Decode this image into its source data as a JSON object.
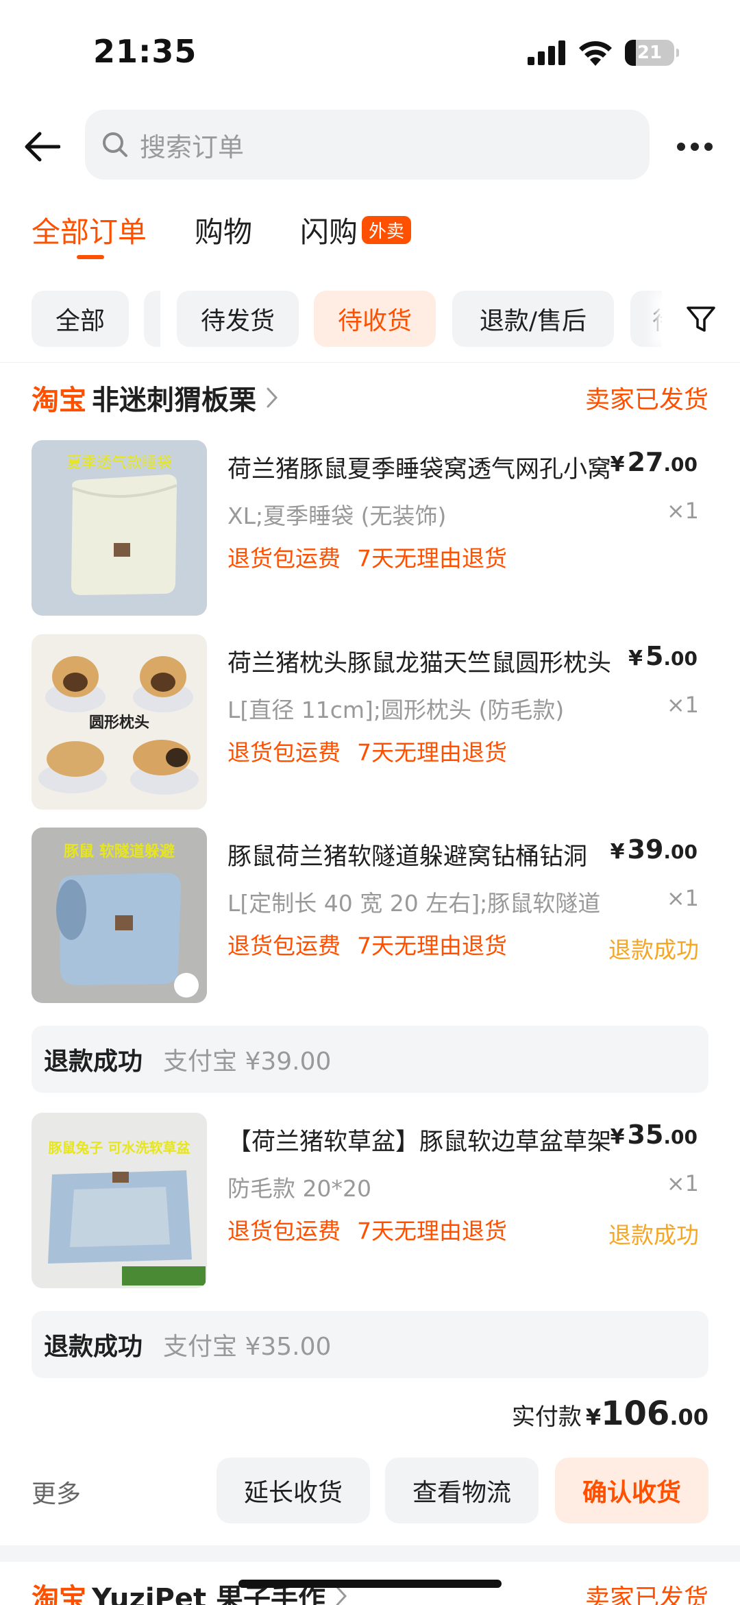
{
  "status_bar": {
    "time": "21:35",
    "battery": "21"
  },
  "search": {
    "placeholder": "搜索订单"
  },
  "tabs": [
    {
      "label": "全部订单"
    },
    {
      "label": "购物"
    },
    {
      "label": "闪购",
      "badge": "外卖"
    }
  ],
  "filters": [
    "全部",
    "待发货",
    "待收货",
    "退款/售后",
    "待"
  ],
  "order": {
    "platform": "淘宝",
    "shop_name": "非迷刺猬板栗",
    "status": "卖家已发货",
    "items": [
      {
        "title": "荷兰猪豚鼠夏季睡袋窝透气网孔小窝",
        "price_int": "27",
        "price_dec": ".00",
        "spec": "XL;夏季睡袋 (无装饰)",
        "qty": "×1",
        "tags": [
          "退货包运费",
          "7天无理由退货"
        ],
        "refund_status": "",
        "image_caption": "夏季透气款睡袋"
      },
      {
        "title": "荷兰猪枕头豚鼠龙猫天竺鼠圆形枕头",
        "price_int": "5",
        "price_dec": ".00",
        "spec": "L[直径 11cm];圆形枕头 (防毛款)",
        "qty": "×1",
        "tags": [
          "退货包运费",
          "7天无理由退货"
        ],
        "refund_status": "",
        "image_caption": "圆形枕头"
      },
      {
        "title": "豚鼠荷兰猪软隧道躲避窝钻桶钻洞",
        "price_int": "39",
        "price_dec": ".00",
        "spec": "L[定制长 40 宽 20 左右];豚鼠软隧道",
        "qty": "×1",
        "tags": [
          "退货包运费",
          "7天无理由退货"
        ],
        "refund_status": "退款成功",
        "image_caption": "豚鼠 软隧道躲避"
      },
      {
        "title": "【荷兰猪软草盆】豚鼠软边草盆草架",
        "price_int": "35",
        "price_dec": ".00",
        "spec": "防毛款 20*20",
        "qty": "×1",
        "tags": [
          "退货包运费",
          "7天无理由退货"
        ],
        "refund_status": "退款成功",
        "image_caption": "豚鼠兔子 可水洗软草盆"
      }
    ],
    "refunds": [
      {
        "label": "退款成功",
        "amount": "支付宝 ¥39.00"
      },
      {
        "label": "退款成功",
        "amount": "支付宝 ¥35.00"
      }
    ],
    "total": {
      "label": "实付款",
      "currency": "¥",
      "int": "106",
      "dec": ".00"
    },
    "more": "更多",
    "actions": [
      "延长收货",
      "查看物流",
      "确认收货"
    ]
  },
  "next_order": {
    "platform": "淘宝",
    "shop_name": "YuziPet 果子手作",
    "status": "卖家已发货"
  },
  "colors": {
    "accent": "#ff5000",
    "refund": "#f5a623",
    "muted": "#999999"
  }
}
